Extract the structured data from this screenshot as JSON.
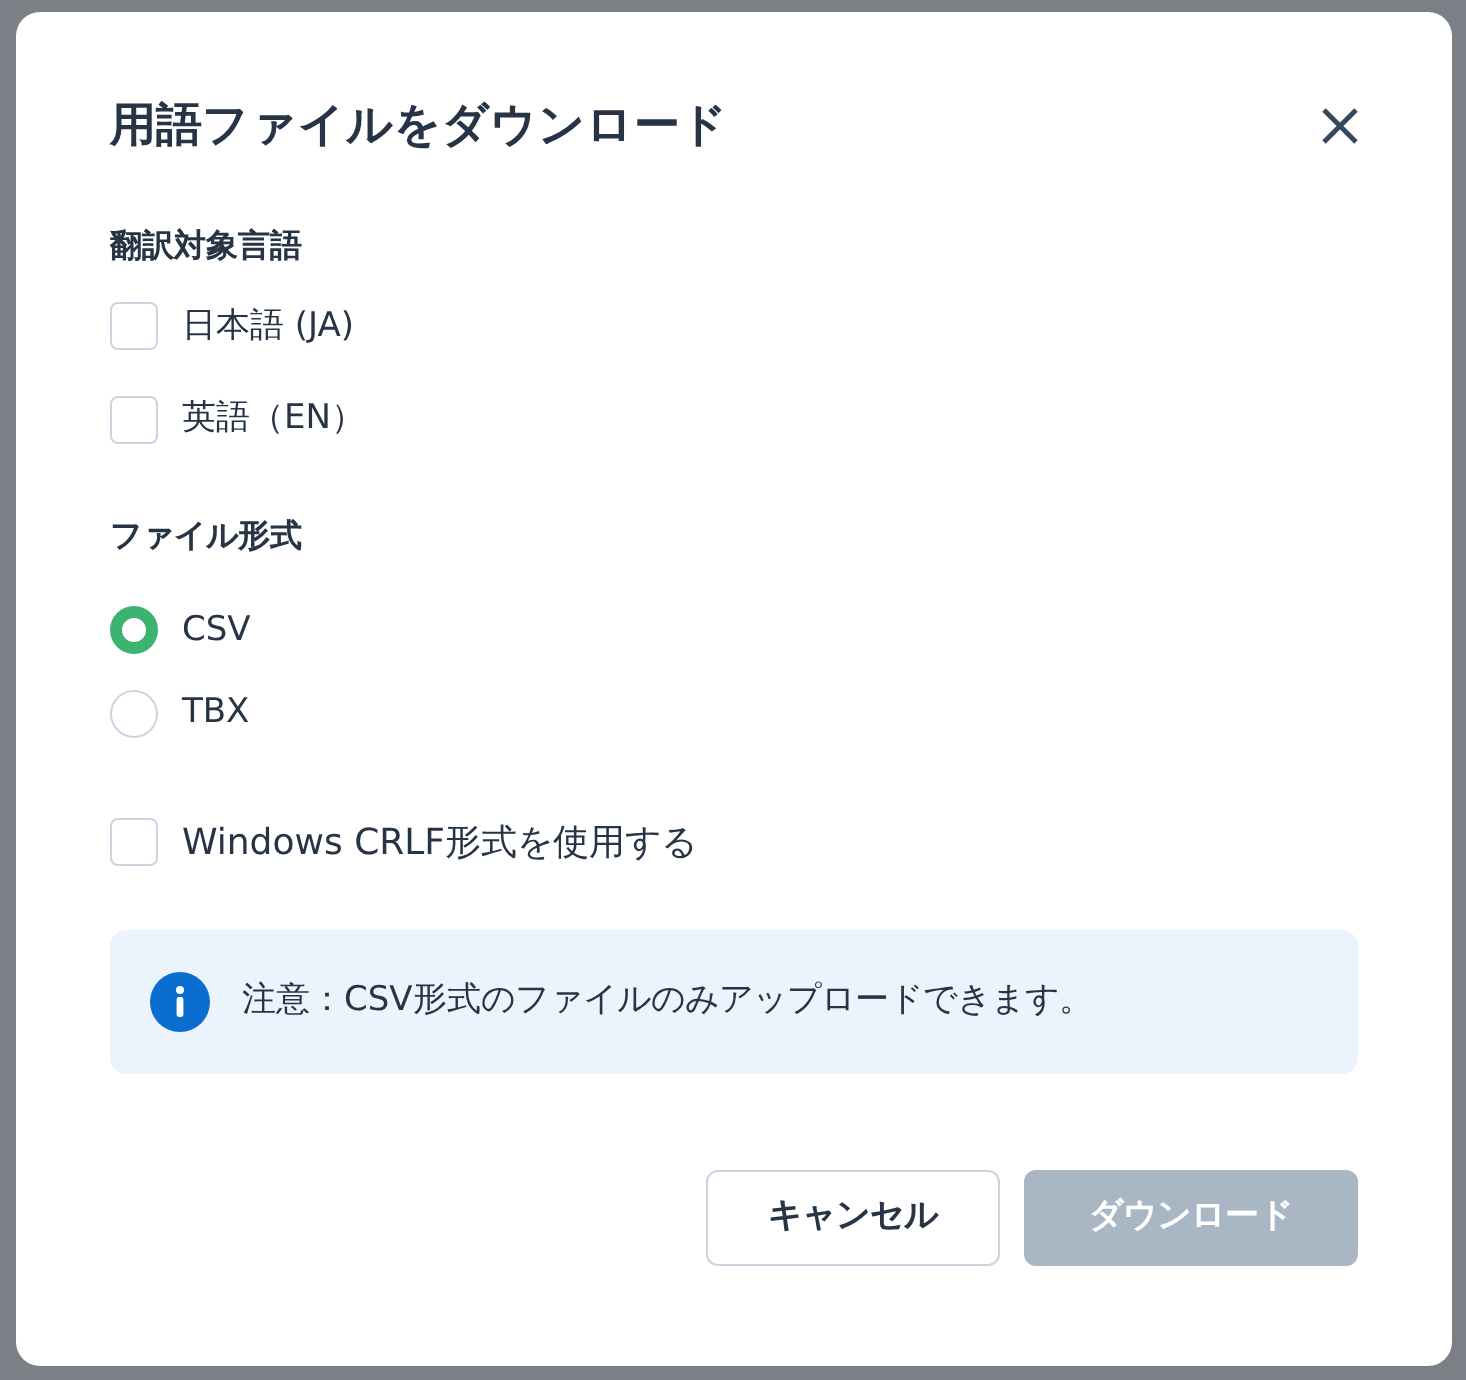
{
  "dialog": {
    "title": "用語ファイルをダウンロード",
    "languages": {
      "label": "翻訳対象言語",
      "options": [
        {
          "label": "日本語 (JA)",
          "checked": false
        },
        {
          "label": "英語（EN）",
          "checked": false
        }
      ]
    },
    "format": {
      "label": "ファイル形式",
      "options": [
        {
          "label": "CSV",
          "selected": true
        },
        {
          "label": "TBX",
          "selected": false
        }
      ]
    },
    "crlf": {
      "label": "Windows CRLF形式を使用する",
      "checked": false
    },
    "notice": "注意：CSV形式のファイルのみアップロードできます。",
    "buttons": [
      {
        "label": "キャンセル",
        "kind": "secondary",
        "disabled": false
      },
      {
        "label": "ダウンロード",
        "kind": "primary",
        "disabled": true
      }
    ]
  }
}
